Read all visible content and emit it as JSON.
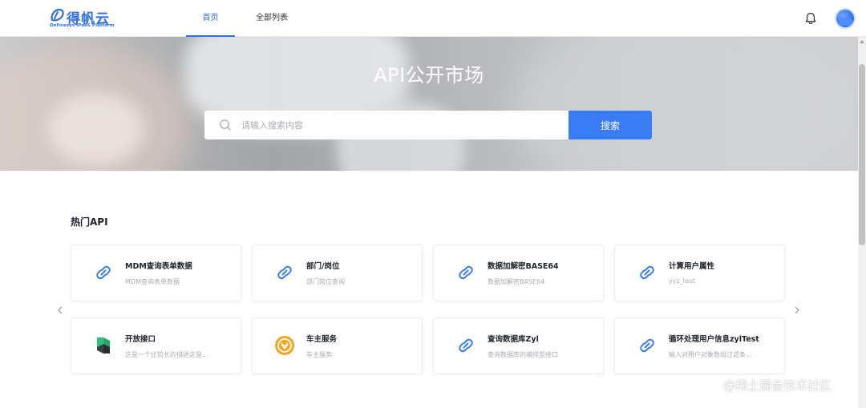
{
  "header": {
    "logo_text": "得帆云",
    "logo_sub": "Definesys iPaaS Platform",
    "tabs": [
      {
        "label": "首页",
        "active": true
      },
      {
        "label": "全部列表",
        "active": false
      }
    ],
    "bell_icon": "bell-icon",
    "avatar_icon": "avatar"
  },
  "hero": {
    "title": "API公开市场",
    "search_placeholder": "请输入搜索内容",
    "search_value": "",
    "search_button": "搜索"
  },
  "hot_api": {
    "title": "热门API",
    "cards": [
      {
        "title": "MDM查询表单数据",
        "desc": "MDM查询表单数据",
        "icon": "link-icon"
      },
      {
        "title": "部门/岗位",
        "desc": "部门岗位查询",
        "icon": "link-icon"
      },
      {
        "title": "数据加解密BASE64",
        "desc": "数据加解密BASE64",
        "icon": "link-icon"
      },
      {
        "title": "计算用户属性",
        "desc": "yyz_test",
        "icon": "link-icon"
      },
      {
        "title": "开放接口",
        "desc": "这是一个比较长的描述这是...",
        "icon": "green-cube-icon"
      },
      {
        "title": "车主服务",
        "desc": "车主服务",
        "icon": "orange-badge-icon"
      },
      {
        "title": "查询数据库Zyl",
        "desc": "查询数据库的编排型接口",
        "icon": "link-icon"
      },
      {
        "title": "循环处理用户信息zylTest",
        "desc": "输入对用户对象数组过滤条...",
        "icon": "link-icon"
      }
    ]
  },
  "colors": {
    "accent": "#3a7cf6",
    "brand": "#2f6fe4"
  },
  "watermark": "@稀土掘金技术社区"
}
